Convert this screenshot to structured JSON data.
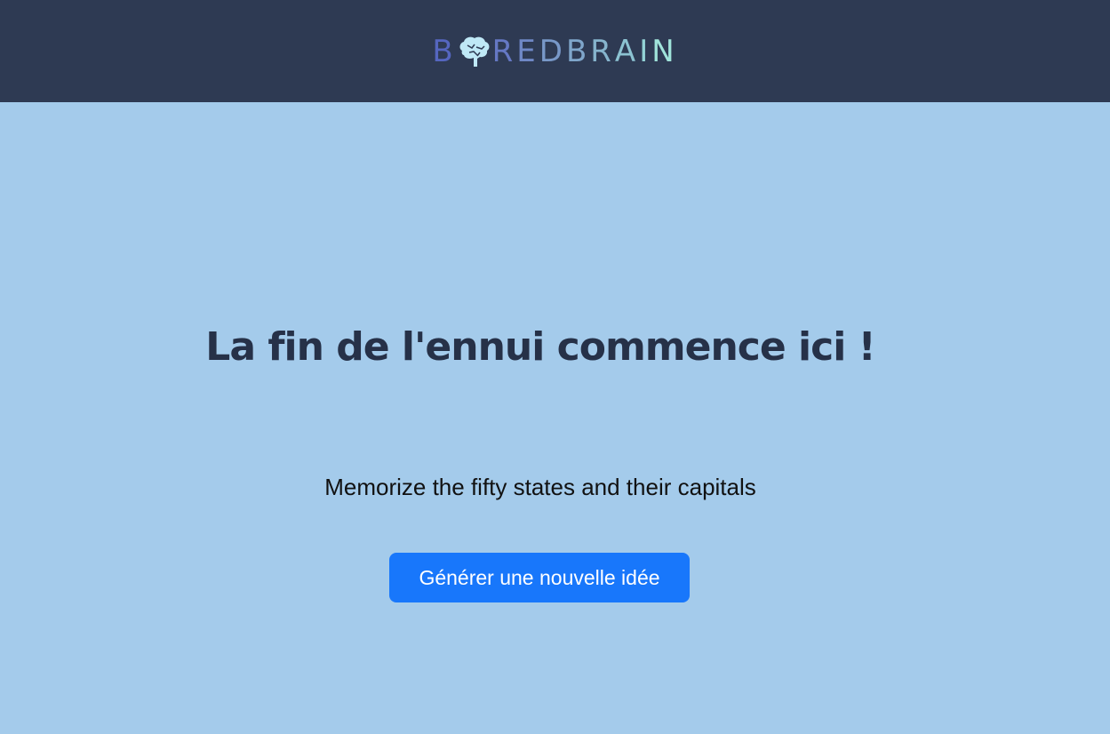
{
  "header": {
    "logo_letters": [
      "B",
      "O",
      "R",
      "E",
      "D",
      "B",
      "R",
      "A",
      "I",
      "N"
    ],
    "logo_colors": [
      "#5566c0",
      "#bfe8f6",
      "#6578c4",
      "#6f88c6",
      "#7898c8",
      "#7fa6cb",
      "#86b4cd",
      "#8cc3d2",
      "#93d3d6",
      "#a0e3da"
    ]
  },
  "main": {
    "headline": "La fin de l'ennui commence ici !",
    "idea": "Memorize the fifty states and their capitals",
    "generate_button": "Générer une nouvelle idée"
  }
}
